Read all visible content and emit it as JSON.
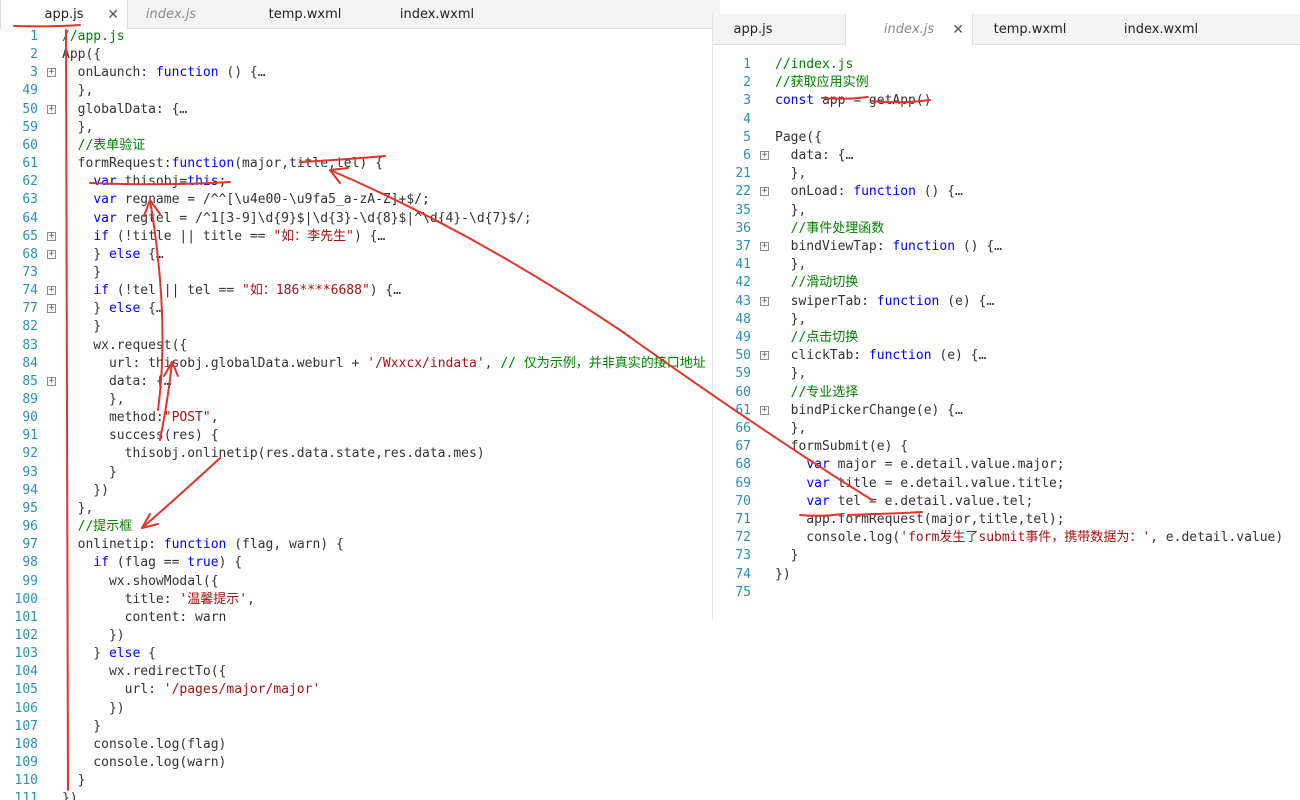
{
  "left": {
    "tabs": [
      {
        "label": "app.js",
        "active": true,
        "italic": false,
        "close": "✕"
      },
      {
        "label": "index.js",
        "active": false,
        "italic": true,
        "close": ""
      },
      {
        "label": "temp.wxml",
        "active": false,
        "italic": false,
        "close": ""
      },
      {
        "label": "index.wxml",
        "active": false,
        "italic": false,
        "close": ""
      }
    ],
    "lines": [
      {
        "n": "1",
        "fold": false,
        "t": [
          [
            "//app.js",
            "cm"
          ]
        ]
      },
      {
        "n": "2",
        "fold": false,
        "t": [
          [
            "App({",
            ""
          ]
        ]
      },
      {
        "n": "3",
        "fold": true,
        "t": [
          [
            "  onLaunch: ",
            ""
          ],
          [
            "function",
            "kw"
          ],
          [
            " () {…",
            ""
          ]
        ]
      },
      {
        "n": "49",
        "fold": false,
        "t": [
          [
            "  },",
            ""
          ]
        ]
      },
      {
        "n": "50",
        "fold": true,
        "t": [
          [
            "  globalData: {…",
            ""
          ]
        ]
      },
      {
        "n": "59",
        "fold": false,
        "t": [
          [
            "  },",
            ""
          ]
        ]
      },
      {
        "n": "60",
        "fold": false,
        "t": [
          [
            "  //表单验证",
            "cm"
          ]
        ]
      },
      {
        "n": "61",
        "fold": false,
        "t": [
          [
            "  formRequest:",
            ""
          ],
          [
            "function",
            "kw"
          ],
          [
            "(major,title,tel) {",
            ""
          ]
        ]
      },
      {
        "n": "62",
        "fold": false,
        "t": [
          [
            "    ",
            ""
          ],
          [
            "var",
            "kw"
          ],
          [
            " thisobj=",
            ""
          ],
          [
            "this",
            "kw"
          ],
          [
            ";",
            ""
          ]
        ]
      },
      {
        "n": "63",
        "fold": false,
        "t": [
          [
            "    ",
            ""
          ],
          [
            "var",
            "kw"
          ],
          [
            " regname = /^^[\\u4e00-\\u9fa5_a-zA-Z]+$/;",
            ""
          ]
        ]
      },
      {
        "n": "64",
        "fold": false,
        "t": [
          [
            "    ",
            ""
          ],
          [
            "var",
            "kw"
          ],
          [
            " regtel = /^1[3-9]\\d{9}$|\\d{3}-\\d{8}$|^\\d{4}-\\d{7}$/;",
            ""
          ]
        ]
      },
      {
        "n": "65",
        "fold": true,
        "t": [
          [
            "    ",
            ""
          ],
          [
            "if",
            "kw"
          ],
          [
            " (!title || title == ",
            ""
          ],
          [
            "\"如：李先生\"",
            "str"
          ],
          [
            ") {…",
            ""
          ]
        ]
      },
      {
        "n": "68",
        "fold": true,
        "t": [
          [
            "    } ",
            ""
          ],
          [
            "else",
            "kw"
          ],
          [
            " {…",
            ""
          ]
        ]
      },
      {
        "n": "73",
        "fold": false,
        "t": [
          [
            "    }",
            ""
          ]
        ]
      },
      {
        "n": "74",
        "fold": true,
        "t": [
          [
            "    ",
            ""
          ],
          [
            "if",
            "kw"
          ],
          [
            " (!tel || tel == ",
            ""
          ],
          [
            "\"如：186****6688\"",
            "str"
          ],
          [
            ") {…",
            ""
          ]
        ]
      },
      {
        "n": "77",
        "fold": true,
        "t": [
          [
            "    } ",
            ""
          ],
          [
            "else",
            "kw"
          ],
          [
            " {…",
            ""
          ]
        ]
      },
      {
        "n": "82",
        "fold": false,
        "t": [
          [
            "    }",
            ""
          ]
        ]
      },
      {
        "n": "83",
        "fold": false,
        "t": [
          [
            "    wx.request({",
            ""
          ]
        ]
      },
      {
        "n": "84",
        "fold": false,
        "t": [
          [
            "      url: thisobj.globalData.weburl + ",
            ""
          ],
          [
            "'/Wxxcx/indata'",
            "str"
          ],
          [
            ", ",
            ""
          ],
          [
            "// 仅为示例，并非真实的接口地址",
            "cm"
          ]
        ]
      },
      {
        "n": "85",
        "fold": true,
        "t": [
          [
            "      data: {…",
            ""
          ]
        ]
      },
      {
        "n": "89",
        "fold": false,
        "t": [
          [
            "      },",
            ""
          ]
        ]
      },
      {
        "n": "90",
        "fold": false,
        "t": [
          [
            "      method:",
            ""
          ],
          [
            "\"POST\"",
            "str"
          ],
          [
            ",",
            ""
          ]
        ]
      },
      {
        "n": "91",
        "fold": false,
        "t": [
          [
            "      success(res) {",
            ""
          ]
        ]
      },
      {
        "n": "92",
        "fold": false,
        "t": [
          [
            "        thisobj.onlinetip(res.data.state,res.data.mes)",
            ""
          ]
        ]
      },
      {
        "n": "93",
        "fold": false,
        "t": [
          [
            "      }",
            ""
          ]
        ]
      },
      {
        "n": "94",
        "fold": false,
        "t": [
          [
            "    })",
            ""
          ]
        ]
      },
      {
        "n": "95",
        "fold": false,
        "t": [
          [
            "  },",
            ""
          ]
        ]
      },
      {
        "n": "96",
        "fold": false,
        "t": [
          [
            "  //提示框",
            "cm"
          ]
        ]
      },
      {
        "n": "97",
        "fold": false,
        "t": [
          [
            "  onlinetip: ",
            ""
          ],
          [
            "function",
            "kw"
          ],
          [
            " (flag, warn) {",
            ""
          ]
        ]
      },
      {
        "n": "98",
        "fold": false,
        "t": [
          [
            "    ",
            ""
          ],
          [
            "if",
            "kw"
          ],
          [
            " (flag == ",
            ""
          ],
          [
            "true",
            "kw"
          ],
          [
            ") {",
            ""
          ]
        ]
      },
      {
        "n": "99",
        "fold": false,
        "t": [
          [
            "      wx.showModal({",
            ""
          ]
        ]
      },
      {
        "n": "100",
        "fold": false,
        "t": [
          [
            "        title: ",
            ""
          ],
          [
            "'温馨提示'",
            "str"
          ],
          [
            ",",
            ""
          ]
        ]
      },
      {
        "n": "101",
        "fold": false,
        "t": [
          [
            "        content: warn",
            ""
          ]
        ]
      },
      {
        "n": "102",
        "fold": false,
        "t": [
          [
            "      })",
            ""
          ]
        ]
      },
      {
        "n": "103",
        "fold": false,
        "t": [
          [
            "    } ",
            ""
          ],
          [
            "else",
            "kw"
          ],
          [
            " {",
            ""
          ]
        ]
      },
      {
        "n": "104",
        "fold": false,
        "t": [
          [
            "      wx.redirectTo({",
            ""
          ]
        ]
      },
      {
        "n": "105",
        "fold": false,
        "t": [
          [
            "        url: ",
            ""
          ],
          [
            "'/pages/major/major'",
            "str"
          ]
        ]
      },
      {
        "n": "106",
        "fold": false,
        "t": [
          [
            "      })",
            ""
          ]
        ]
      },
      {
        "n": "107",
        "fold": false,
        "t": [
          [
            "    }",
            ""
          ]
        ]
      },
      {
        "n": "108",
        "fold": false,
        "t": [
          [
            "    console.log(flag)",
            ""
          ]
        ]
      },
      {
        "n": "109",
        "fold": false,
        "t": [
          [
            "    console.log(warn)",
            ""
          ]
        ]
      },
      {
        "n": "110",
        "fold": false,
        "t": [
          [
            "  }",
            ""
          ]
        ]
      },
      {
        "n": "111",
        "fold": false,
        "t": [
          [
            "})",
            ""
          ]
        ]
      }
    ]
  },
  "right": {
    "tabs": [
      {
        "label": "app.js",
        "active": false,
        "italic": false,
        "close": ""
      },
      {
        "label": "index.js",
        "active": true,
        "italic": true,
        "close": "✕"
      },
      {
        "label": "temp.wxml",
        "active": false,
        "italic": false,
        "close": ""
      },
      {
        "label": "index.wxml",
        "active": false,
        "italic": false,
        "close": ""
      }
    ],
    "lines": [
      {
        "n": "1",
        "fold": false,
        "t": [
          [
            "//index.js",
            "cm"
          ]
        ]
      },
      {
        "n": "2",
        "fold": false,
        "t": [
          [
            "//获取应用实例",
            "cm"
          ]
        ]
      },
      {
        "n": "3",
        "fold": false,
        "t": [
          [
            "const",
            "kw"
          ],
          [
            " app = getApp()",
            ""
          ]
        ]
      },
      {
        "n": "4",
        "fold": false,
        "t": [
          [
            "",
            ""
          ]
        ]
      },
      {
        "n": "5",
        "fold": false,
        "t": [
          [
            "Page({",
            ""
          ]
        ]
      },
      {
        "n": "6",
        "fold": true,
        "t": [
          [
            "  data: {…",
            ""
          ]
        ]
      },
      {
        "n": "21",
        "fold": false,
        "t": [
          [
            "  },",
            ""
          ]
        ]
      },
      {
        "n": "22",
        "fold": true,
        "t": [
          [
            "  onLoad: ",
            ""
          ],
          [
            "function",
            "kw"
          ],
          [
            " () {…",
            ""
          ]
        ]
      },
      {
        "n": "35",
        "fold": false,
        "t": [
          [
            "  },",
            ""
          ]
        ]
      },
      {
        "n": "36",
        "fold": false,
        "t": [
          [
            "  //事件处理函数",
            "cm"
          ]
        ]
      },
      {
        "n": "37",
        "fold": true,
        "t": [
          [
            "  bindViewTap: ",
            ""
          ],
          [
            "function",
            "kw"
          ],
          [
            " () {…",
            ""
          ]
        ]
      },
      {
        "n": "41",
        "fold": false,
        "t": [
          [
            "  },",
            ""
          ]
        ]
      },
      {
        "n": "42",
        "fold": false,
        "t": [
          [
            "  //滑动切换",
            "cm"
          ]
        ]
      },
      {
        "n": "43",
        "fold": true,
        "t": [
          [
            "  swiperTab: ",
            ""
          ],
          [
            "function",
            "kw"
          ],
          [
            " (e) {…",
            ""
          ]
        ]
      },
      {
        "n": "48",
        "fold": false,
        "t": [
          [
            "  },",
            ""
          ]
        ]
      },
      {
        "n": "49",
        "fold": false,
        "t": [
          [
            "  //点击切换",
            "cm"
          ]
        ]
      },
      {
        "n": "50",
        "fold": true,
        "t": [
          [
            "  clickTab: ",
            ""
          ],
          [
            "function",
            "kw"
          ],
          [
            " (e) {…",
            ""
          ]
        ]
      },
      {
        "n": "59",
        "fold": false,
        "t": [
          [
            "  },",
            ""
          ]
        ]
      },
      {
        "n": "60",
        "fold": false,
        "t": [
          [
            "  //专业选择",
            "cm"
          ]
        ]
      },
      {
        "n": "61",
        "fold": true,
        "t": [
          [
            "  bindPickerChange(e) {…",
            ""
          ]
        ]
      },
      {
        "n": "66",
        "fold": false,
        "t": [
          [
            "  },",
            ""
          ]
        ]
      },
      {
        "n": "67",
        "fold": false,
        "t": [
          [
            "  formSubmit(e) {",
            ""
          ]
        ]
      },
      {
        "n": "68",
        "fold": false,
        "t": [
          [
            "    ",
            ""
          ],
          [
            "var",
            "kw"
          ],
          [
            " major = e.detail.value.major;",
            ""
          ]
        ]
      },
      {
        "n": "69",
        "fold": false,
        "t": [
          [
            "    ",
            ""
          ],
          [
            "var",
            "kw"
          ],
          [
            " title = e.detail.value.title;",
            ""
          ]
        ]
      },
      {
        "n": "70",
        "fold": false,
        "t": [
          [
            "    ",
            ""
          ],
          [
            "var",
            "kw"
          ],
          [
            " tel = e.detail.value.tel;",
            ""
          ]
        ]
      },
      {
        "n": "71",
        "fold": false,
        "t": [
          [
            "    app.formRequest(major,title,tel);",
            ""
          ]
        ]
      },
      {
        "n": "72",
        "fold": false,
        "t": [
          [
            "    console.log(",
            ""
          ],
          [
            "'form发生了submit事件，携带数据为：'",
            "str"
          ],
          [
            ", e.detail.value)",
            ""
          ]
        ]
      },
      {
        "n": "73",
        "fold": false,
        "t": [
          [
            "  }",
            ""
          ]
        ]
      },
      {
        "n": "74",
        "fold": false,
        "t": [
          [
            "})",
            ""
          ]
        ]
      },
      {
        "n": "75",
        "fold": false,
        "t": [
          [
            "",
            ""
          ]
        ]
      }
    ]
  },
  "colors": {
    "annotation": "#e0342c",
    "line_number": "#2b91af",
    "keyword": "#0000ff",
    "string": "#a31515",
    "comment": "#008000"
  }
}
